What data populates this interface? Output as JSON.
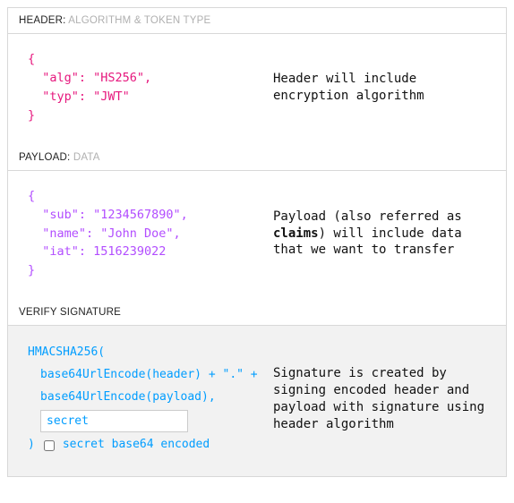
{
  "header_section": {
    "title_strong": "HEADER:",
    "title_weak": "ALGORITHM & TOKEN TYPE",
    "code": "{\n  \"alg\": \"HS256\",\n  \"typ\": \"JWT\"\n}",
    "note_line1": "Header will include",
    "note_line2": "encryption algorithm"
  },
  "payload_section": {
    "title_strong": "PAYLOAD:",
    "title_weak": "DATA",
    "code": "{\n  \"sub\": \"1234567890\",\n  \"name\": \"John Doe\",\n  \"iat\": 1516239022\n}",
    "note_before_bold": "Payload (also referred as ",
    "note_bold": "claims",
    "note_after_bold": ") will include data that we want to transfer"
  },
  "signature_section": {
    "title_strong": "VERIFY SIGNATURE",
    "line1": "HMACSHA256(",
    "line2": "base64UrlEncode(header) + \".\" +",
    "line3": "base64UrlEncode(payload),",
    "secret_value": "secret",
    "close_paren": ")",
    "checkbox_label": "secret base64 encoded",
    "note": "Signature is created by signing encoded header and payload with signature using header algorithm"
  }
}
